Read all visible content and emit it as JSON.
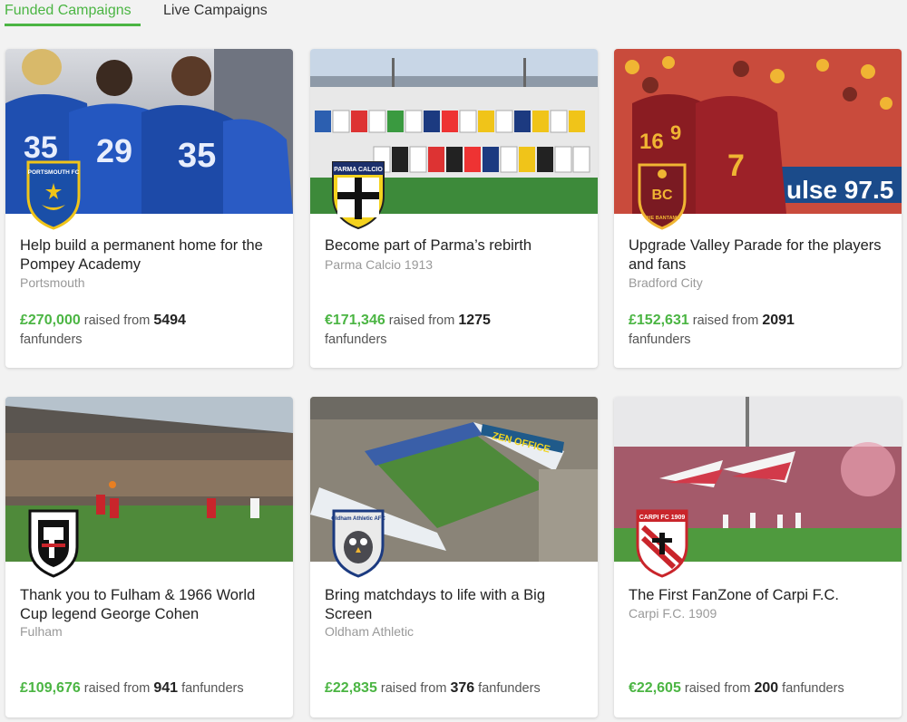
{
  "tabs": {
    "funded": "Funded Campaigns",
    "live": "Live Campaigns"
  },
  "colors": {
    "accent": "#4bb543"
  },
  "labels": {
    "raised_from": "raised from",
    "fanfunders": "fanfunders"
  },
  "campaigns": [
    {
      "title": "Help build a permanent home for the Pompey Academy",
      "club": "Portsmouth",
      "amount": "£270,000",
      "backers": "5494",
      "crest_text": "PORTSMOUTH FC"
    },
    {
      "title": "Become part of Parma’s rebirth",
      "club": "Parma Calcio 1913",
      "amount": "€171,346",
      "backers": "1275",
      "crest_text": "PARMA CALCIO"
    },
    {
      "title": "Upgrade Valley Parade for the players and fans",
      "club": "Bradford City",
      "amount": "£152,631",
      "backers": "2091",
      "crest_text": "THE BANTAMS"
    },
    {
      "title": "Thank you to Fulham & 1966 World Cup legend George Cohen",
      "club": "Fulham",
      "amount": "£109,676",
      "backers": "941",
      "crest_text": ""
    },
    {
      "title": "Bring matchdays to life with a Big Screen",
      "club": "Oldham Athletic",
      "amount": "£22,835",
      "backers": "376",
      "crest_text": "Oldham Athletic AFC"
    },
    {
      "title": "The First FanZone of Carpi F.C.",
      "club": "Carpi F.C. 1909",
      "amount": "€22,605",
      "backers": "200",
      "crest_text": "CARPI FC 1909"
    }
  ],
  "photo_text": {
    "banner_3": "ulse 97.5",
    "banner_5": "ZEN OFFICE"
  }
}
